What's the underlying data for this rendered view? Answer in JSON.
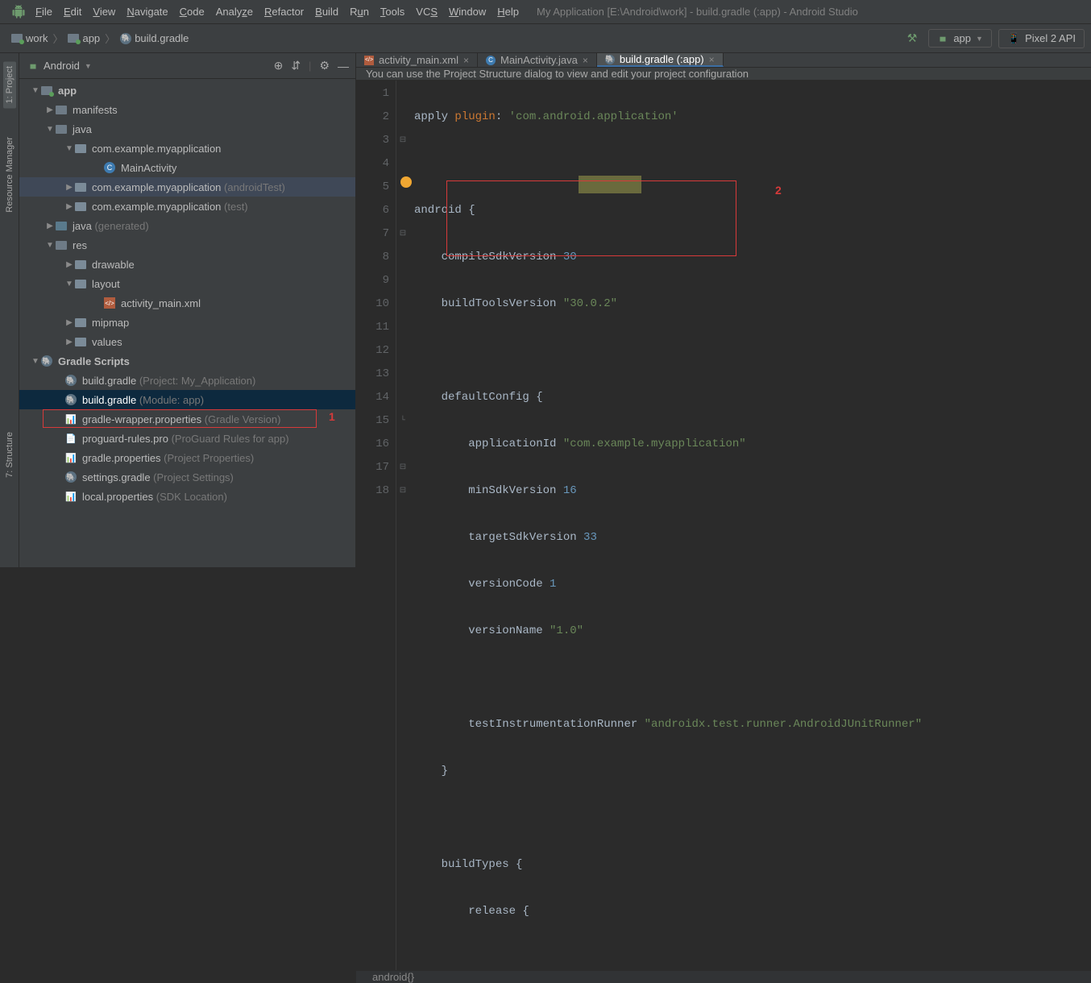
{
  "window": {
    "title": "My Application [E:\\Android\\work] - build.gradle (:app) - Android Studio"
  },
  "menu": {
    "file": "File",
    "edit": "Edit",
    "view": "View",
    "navigate": "Navigate",
    "code": "Code",
    "analyze": "Analyze",
    "refactor": "Refactor",
    "build": "Build",
    "run": "Run",
    "tools": "Tools",
    "vcs": "VCS",
    "window": "Window",
    "help": "Help"
  },
  "breadcrumb": {
    "c1": "work",
    "c2": "app",
    "c3": "build.gradle"
  },
  "toolbar": {
    "config": "app",
    "device": "Pixel 2 API"
  },
  "sidebar_tools": {
    "project": "1: Project",
    "resource": "Resource Manager",
    "structure": "7: Structure"
  },
  "project": {
    "view_label": "Android",
    "tree": {
      "app": "app",
      "manifests": "manifests",
      "java": "java",
      "pkg_main": "com.example.myapplication",
      "main_activity": "MainActivity",
      "pkg_atest": "com.example.myapplication",
      "pkg_atest_suffix": " (androidTest)",
      "pkg_test": "com.example.myapplication",
      "pkg_test_suffix": " (test)",
      "java_gen": "java",
      "java_gen_suffix": " (generated)",
      "res": "res",
      "drawable": "drawable",
      "layout": "layout",
      "activity_main_xml": "activity_main.xml",
      "mipmap": "mipmap",
      "values": "values",
      "gradle_scripts": "Gradle Scripts",
      "build_project": "build.gradle",
      "build_project_suffix": " (Project: My_Application)",
      "build_module": "build.gradle",
      "build_module_suffix": " (Module: app)",
      "gradle_wrapper": "gradle-wrapper.properties",
      "gradle_wrapper_suffix": " (Gradle Version)",
      "proguard": "proguard-rules.pro",
      "proguard_suffix": " (ProGuard Rules for app)",
      "gradle_props": "gradle.properties",
      "gradle_props_suffix": " (Project Properties)",
      "settings": "settings.gradle",
      "settings_suffix": " (Project Settings)",
      "local_props": "local.properties",
      "local_props_suffix": " (SDK Location)"
    }
  },
  "tabs": {
    "t1": "activity_main.xml",
    "t2": "MainActivity.java",
    "t3": "build.gradle (:app)"
  },
  "info_bar": "You can use the Project Structure dialog to view and edit your project configuration",
  "code": {
    "l1a": "apply ",
    "l1b": "plugin",
    "l1c": ": ",
    "l1d": "'com.android.application'",
    "l3a": "android ",
    "l3b": "{",
    "l4a": "    compileSdkVersion ",
    "l4b": "30",
    "l5a": "    buildToolsVersion ",
    "l5b": "\"30.0.2\"",
    "l7a": "    defaultConfig ",
    "l7b": "{",
    "l8a": "        applicationId ",
    "l8b": "\"com.example.myapplication\"",
    "l9a": "        minSdkVersion ",
    "l9b": "16",
    "l10a": "        targetSdkVersion ",
    "l10b": "33",
    "l11a": "        versionCode ",
    "l11b": "1",
    "l12a": "        versionName ",
    "l12b": "\"1.0\"",
    "l14a": "        testInstrumentationRunner ",
    "l14b": "\"androidx.test.runner.AndroidJUnitRunner\"",
    "l15": "    }",
    "l17a": "    buildTypes ",
    "l17b": "{",
    "l18a": "        release ",
    "l18b": "{"
  },
  "editor_footer": "android{}",
  "annotations": {
    "a1": "1",
    "a2": "2"
  }
}
